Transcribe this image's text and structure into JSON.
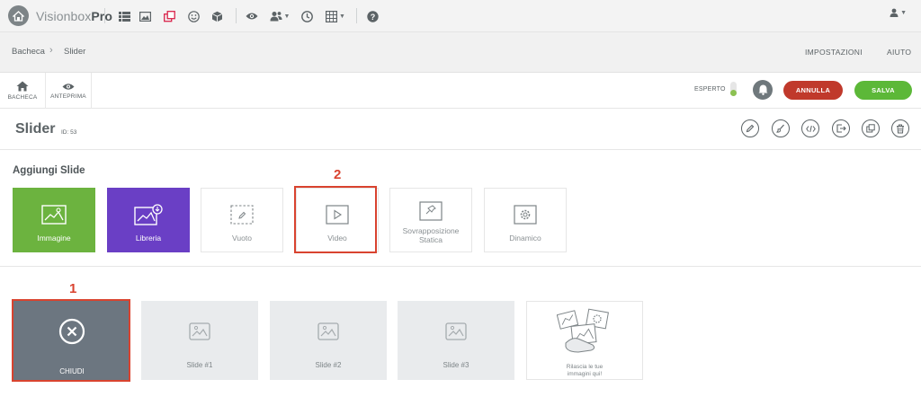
{
  "app": {
    "brand_light": "Visionbox",
    "brand_bold": "Pro"
  },
  "topbar": {
    "icons": [
      "list-icon",
      "image-icon",
      "layers-icon",
      "smile-icon",
      "box-icon",
      "eye-icon",
      "users-icon",
      "clock-icon",
      "grid-icon",
      "help-icon"
    ],
    "user_icon": "user-icon"
  },
  "breadcrumb": {
    "items": [
      "Bacheca",
      "Slider"
    ]
  },
  "topnav": {
    "settings": "IMPOSTAZIONI",
    "help": "AIUTO"
  },
  "toolbar": {
    "dashboard_label": "BACHECA",
    "preview_label": "ANTEPRIMA",
    "expert_label": "ESPERTO",
    "cancel_label": "ANNULLA",
    "save_label": "SALVA"
  },
  "page": {
    "title": "Slider",
    "id_label": "ID: 53"
  },
  "add_slide": {
    "title": "Aggiungi Slide",
    "tiles": [
      {
        "label": "Immagine"
      },
      {
        "label": "Libreria"
      },
      {
        "label": "Vuoto"
      },
      {
        "label": "Video"
      },
      {
        "label": "Sovrapposizione Statica"
      },
      {
        "label": "Dinamico"
      }
    ]
  },
  "annotations": {
    "one": "1",
    "two": "2"
  },
  "slides": {
    "close_label": "CHIUDI",
    "items": [
      {
        "label": "Slide #1"
      },
      {
        "label": "Slide #2"
      },
      {
        "label": "Slide #3"
      }
    ],
    "drop_label": "Rilascia le tue immagini qui!"
  },
  "colors": {
    "green": "#6cb33f",
    "purple": "#6a3fc5",
    "cancel": "#c0392b",
    "save": "#5cb838",
    "highlight": "#d9432f"
  }
}
